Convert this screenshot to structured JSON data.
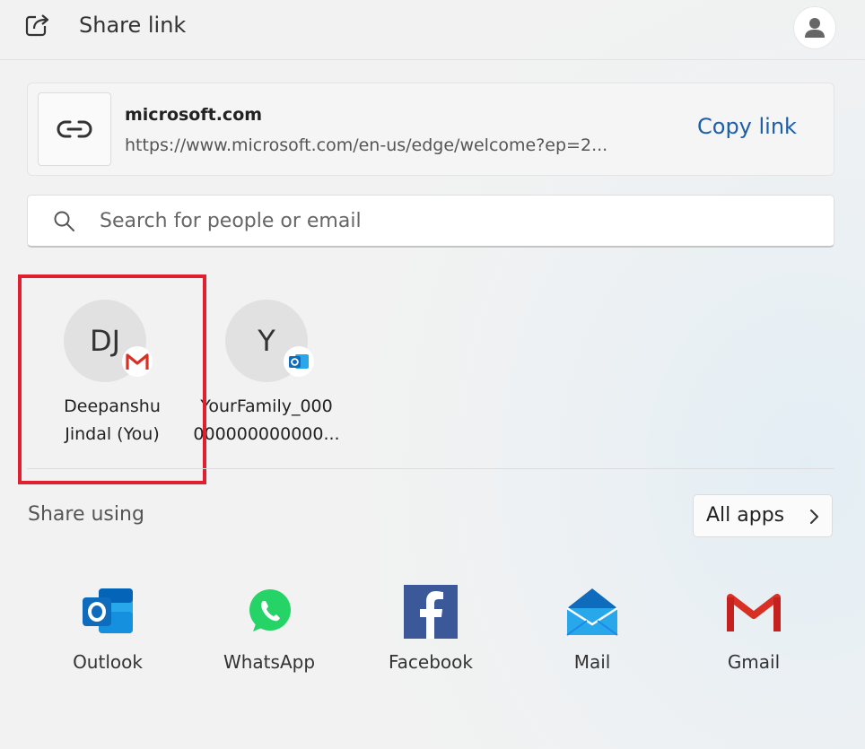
{
  "header": {
    "title": "Share link",
    "icons": {
      "share": "share-icon",
      "account": "account-icon"
    }
  },
  "link_card": {
    "site": "microsoft.com",
    "url": "https://www.microsoft.com/en-us/edge/welcome?ep=2...",
    "copy_label": "Copy link",
    "icon": "link-icon"
  },
  "search": {
    "placeholder": "Search for people or email",
    "value": ""
  },
  "contacts": [
    {
      "initials": "DJ",
      "name_line1": "Deepanshu",
      "name_line2": "Jindal (You)",
      "badge": "gmail-icon"
    },
    {
      "initials": "Y",
      "name_line1": "YourFamily_000",
      "name_line2": "000000000000...",
      "badge": "outlook-icon"
    }
  ],
  "share_using": {
    "label": "Share using",
    "all_apps_label": "All apps"
  },
  "apps": [
    {
      "label": "Outlook",
      "icon": "outlook-icon"
    },
    {
      "label": "WhatsApp",
      "icon": "whatsapp-icon"
    },
    {
      "label": "Facebook",
      "icon": "facebook-icon"
    },
    {
      "label": "Mail",
      "icon": "mail-icon"
    },
    {
      "label": "Gmail",
      "icon": "gmail-icon"
    }
  ],
  "colors": {
    "accent": "#1c5ea8",
    "highlight": "#e02030",
    "outlook": "#0f6cbd",
    "whatsapp": "#25d366",
    "facebook": "#1877f2",
    "mail": "#1e88e5",
    "gmail": "#d93025"
  }
}
